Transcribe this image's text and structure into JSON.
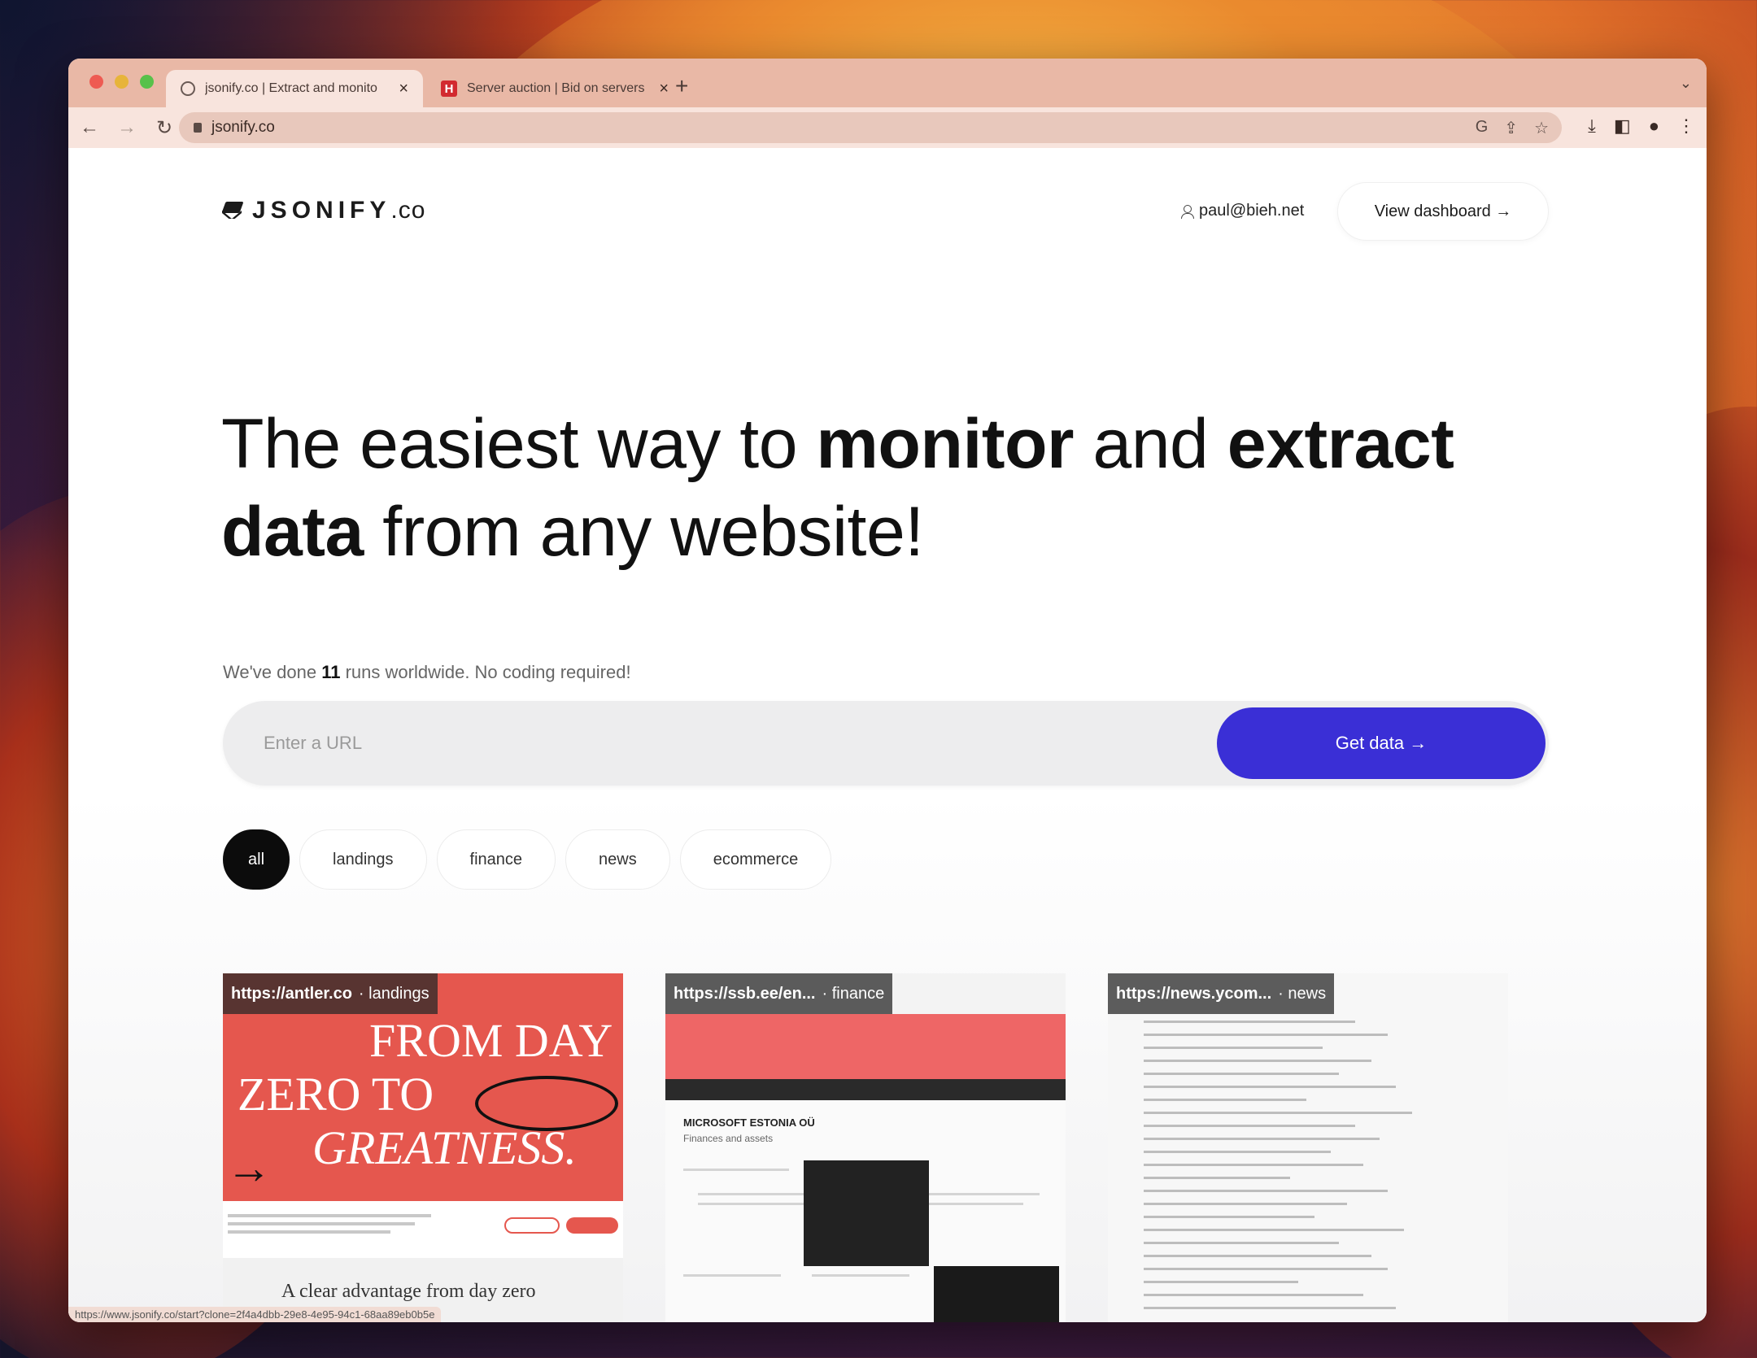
{
  "browser": {
    "tabs": [
      {
        "title": "jsonify.co | Extract and monito"
      },
      {
        "title": "Server auction | Bid on servers"
      }
    ],
    "new_tab": "+",
    "address": "jsonify.co",
    "status_url": "https://www.jsonify.co/start?clone=2f4a4dbb-29e8-4e95-94c1-68aa89eb0b5e"
  },
  "header": {
    "logo_main": "JSONIFY",
    "logo_suffix": ".co",
    "user_email": "paul@bieh.net",
    "dashboard_label": "View dashboard →"
  },
  "hero": {
    "t1": "The easiest way to ",
    "t2": "monitor",
    "t3": " and ",
    "t4": "extract",
    "t5": "data",
    "t6": " from any website!"
  },
  "stats": {
    "pre": "We've done ",
    "count": "11",
    "post": " runs worldwide. No coding required!"
  },
  "search": {
    "placeholder": "Enter a URL",
    "button": "Get data →"
  },
  "filters": [
    "all",
    "landings",
    "finance",
    "news",
    "ecommerce"
  ],
  "cards": [
    {
      "url": "https://antler.co",
      "category": "· landings",
      "line1": "FROM DAY",
      "line2": "ZERO TO",
      "line3": "GREATNESS.",
      "tagline": "A clear advantage from day zero"
    },
    {
      "url": "https://ssb.ee/en...",
      "category": "· finance",
      "company": "MICROSOFT ESTONIA OÜ",
      "subtitle": "Finances and assets"
    },
    {
      "url": "https://news.ycom...",
      "category": "· news"
    }
  ],
  "colors": {
    "accent": "#3a2fd6",
    "active_chip": "#0c0c0c"
  }
}
